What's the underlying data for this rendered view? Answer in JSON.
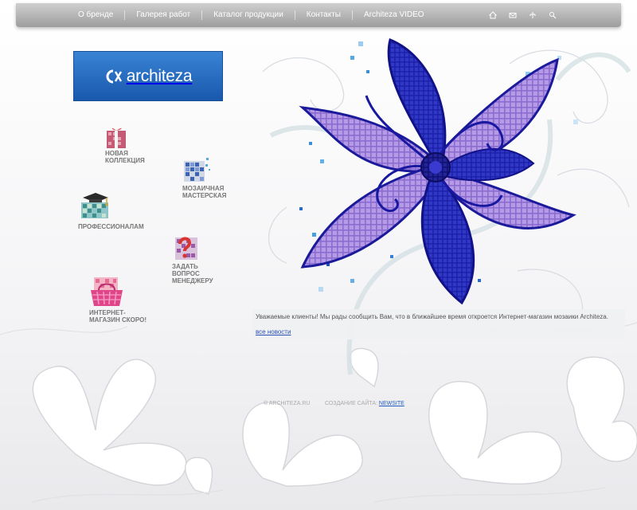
{
  "nav": {
    "items": [
      "О бренде",
      "Галерея работ",
      "Каталог продукции",
      "Контакты",
      "Architeza VIDEO"
    ],
    "icons": [
      "home-icon",
      "mail-icon",
      "sitemap-icon",
      "search-icon"
    ]
  },
  "logo": {
    "text": "architeza"
  },
  "menu": {
    "new_collection": "Новая коллекция",
    "mosaic_workshop": "Мозаичная мастерская",
    "professionals": "Профессионалам",
    "ask_manager": "Задать вопрос менеджеру",
    "shop": "Интернет-магазин скоро!"
  },
  "news": {
    "text": "Уважаемые клиенты! Мы рады сообщить Вам, что в ближайшее время откроется Интернет-магазин мозаики Architeza.",
    "all_news": "все новости"
  },
  "footer": {
    "copyright": "© ARCHITEZA.RU",
    "created_by": "СОЗДАНИЕ САЙТА:",
    "studio": "NEWSITE"
  },
  "colors": {
    "logo_blue": "#1f63b8",
    "flower_blue": "#2a2ab8",
    "flower_violet": "#9a78d0",
    "nav_gray": "#b4b4b4"
  }
}
